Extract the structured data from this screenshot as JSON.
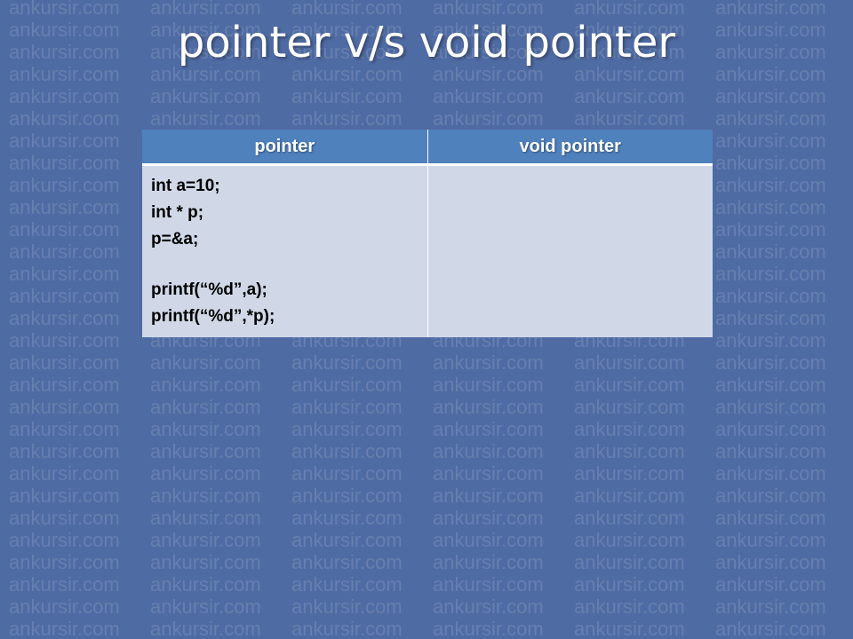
{
  "slide": {
    "title": "pointer v/s void pointer",
    "watermark": "ankursir.com"
  },
  "table": {
    "headers": [
      "pointer",
      "void pointer"
    ],
    "pointer_code": [
      "int a=10;",
      "int * p;",
      "p=&a;",
      "printf(“%d”,a);",
      "printf(“%d”,*p);"
    ],
    "void_pointer_code": []
  },
  "colors": {
    "background": "#4f6ba3",
    "header": "#4f81bd",
    "cell": "#d0d8e8"
  }
}
